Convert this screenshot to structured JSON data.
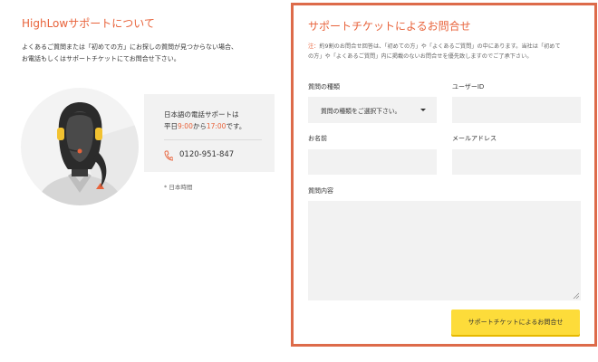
{
  "left": {
    "title": "HighLowサポートについて",
    "desc_line1": "よくあるご質問または「初めての方」にお探しの質問が見つからない場合、",
    "desc_line2": "お電話もしくはサポートチケットにてお問合せ下さい。",
    "phone_service": "日本語の電話サポートは",
    "hours_prefix": "平日",
    "hours_start": "9:00",
    "hours_mid": "から",
    "hours_end": "17:00",
    "hours_suffix": "です。",
    "phone_number": "0120-951-847",
    "timezone_note": "* 日本時間",
    "phone_icon": "phone-icon",
    "avatar_icon": "support-operator-avatar"
  },
  "form": {
    "title": "サポートチケットによるお問合せ",
    "note_prefix": "注：",
    "note_line1": "約9割のお問合せ回答は、「初めての方」や「よくあるご質問」の中にあります。当社は「初めて",
    "note_line2": "の方」や「よくあるご質問」内に掲載のないお問合せを優先致しますのでご了承下さい。",
    "question_type_label": "質問の種類",
    "question_type_value": "質問の種類をご選択下さい。",
    "user_id_label": "ユーザーID",
    "user_id_value": "",
    "name_label": "お名前",
    "name_value": "",
    "email_label": "メールアドレス",
    "email_value": "",
    "content_label": "質問内容",
    "content_value": "",
    "submit_label": "サポートチケットによるお問合せ"
  },
  "colors": {
    "accent": "#e8633b",
    "panel_border": "#dd6b4a",
    "button": "#fddc3a",
    "field_bg": "#f2f2f2"
  }
}
